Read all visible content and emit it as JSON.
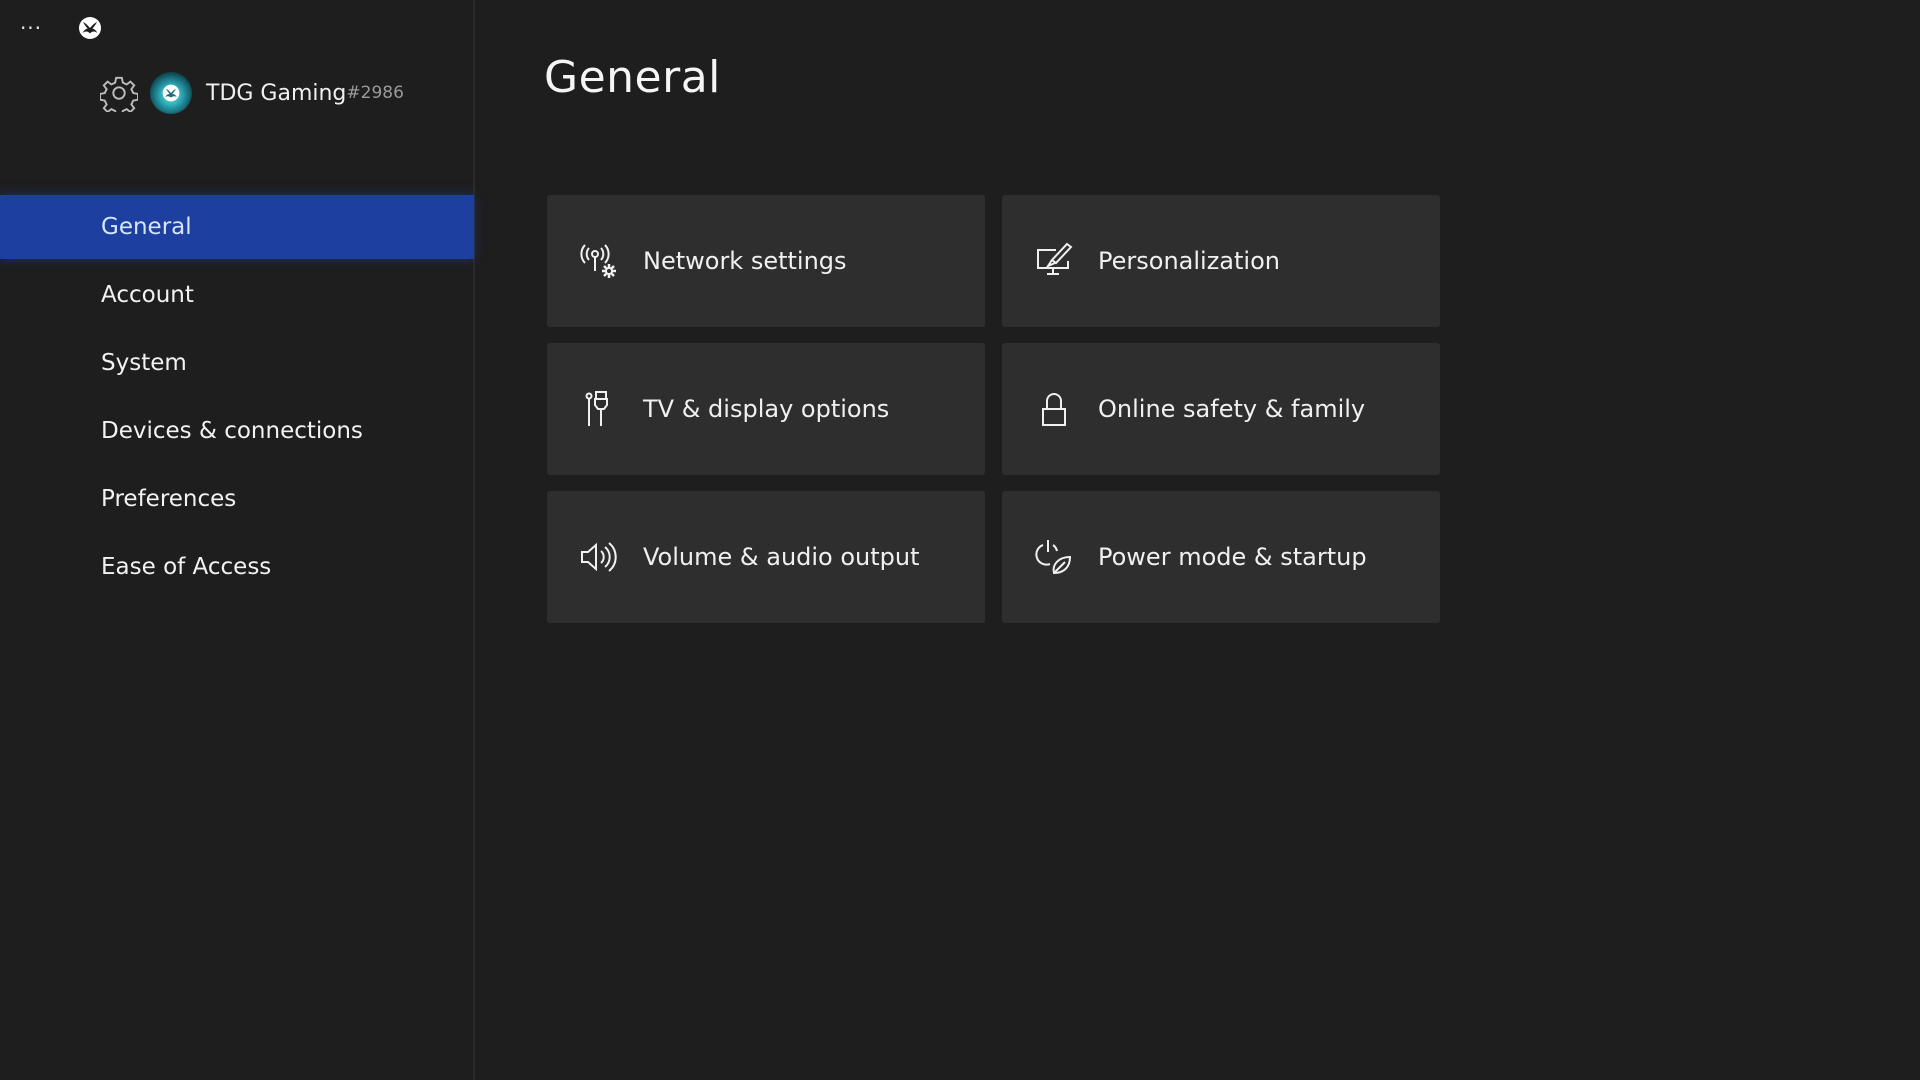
{
  "topbar": {
    "more_label": "···",
    "more_icon": "more-horizontal-icon",
    "home_icon": "xbox-logo-icon"
  },
  "profile": {
    "settings_icon": "gear-icon",
    "avatar_icon": "xbox-avatar",
    "gamertag": "TDG Gaming",
    "gamertag_suffix": "#2986"
  },
  "sidebar": {
    "items": [
      {
        "label": "General",
        "active": true
      },
      {
        "label": "Account",
        "active": false
      },
      {
        "label": "System",
        "active": false
      },
      {
        "label": "Devices & connections",
        "active": false
      },
      {
        "label": "Preferences",
        "active": false
      },
      {
        "label": "Ease of Access",
        "active": false
      }
    ]
  },
  "main": {
    "title": "General",
    "tiles": [
      {
        "label": "Network settings",
        "icon": "network-settings-icon"
      },
      {
        "label": "Personalization",
        "icon": "personalization-icon"
      },
      {
        "label": "TV & display options",
        "icon": "tv-display-icon"
      },
      {
        "label": "Online safety & family",
        "icon": "lock-icon"
      },
      {
        "label": "Volume & audio output",
        "icon": "speaker-icon"
      },
      {
        "label": "Power mode & startup",
        "icon": "power-leaf-icon"
      }
    ]
  },
  "colors": {
    "background": "#1e1e1e",
    "tile": "#2e2e2e",
    "accent": "#1c3fa0"
  }
}
